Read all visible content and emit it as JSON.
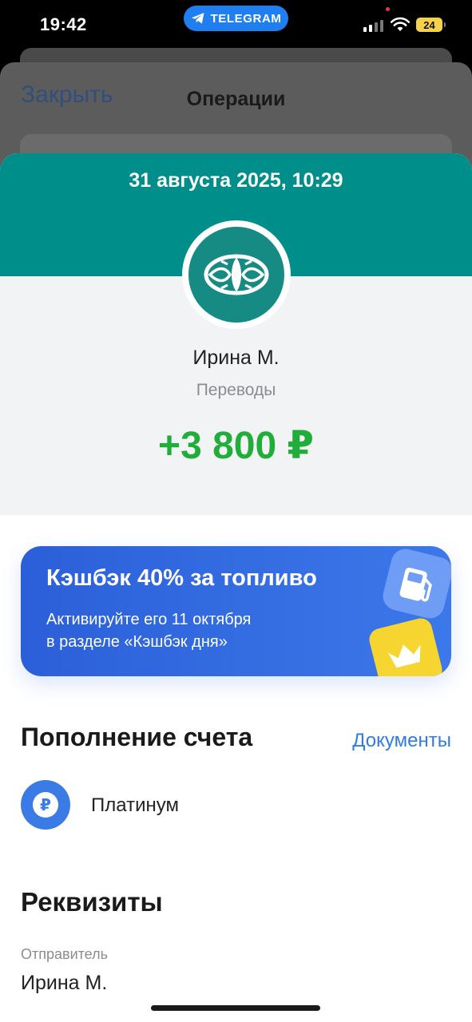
{
  "status_bar": {
    "time": "19:42",
    "app_pill": "TELEGRAM",
    "battery": "24",
    "pill_color": "#1f7ef0"
  },
  "background_sheet": {
    "close": "Закрыть",
    "title": "Операции"
  },
  "operation": {
    "date": "31 августа 2025, 10:29",
    "name": "Ирина М.",
    "category": "Переводы",
    "amount": "+3 800 ₽",
    "header_color": "#008e8a",
    "amount_color": "#21ad3a"
  },
  "promo": {
    "title": "Кэшбэк 40% за топливо",
    "line1": "Активируйте его 11 октября",
    "line2": "в разделе «Кэшбэк дня»",
    "icons": [
      "fuel-icon",
      "crown-icon"
    ]
  },
  "section": {
    "title": "Пополнение счета",
    "documents": "Документы",
    "account": "Платинум",
    "account_icon": "ruble-icon"
  },
  "details": {
    "title": "Реквизиты",
    "sender_label": "Отправитель",
    "sender_value": "Ирина М."
  }
}
